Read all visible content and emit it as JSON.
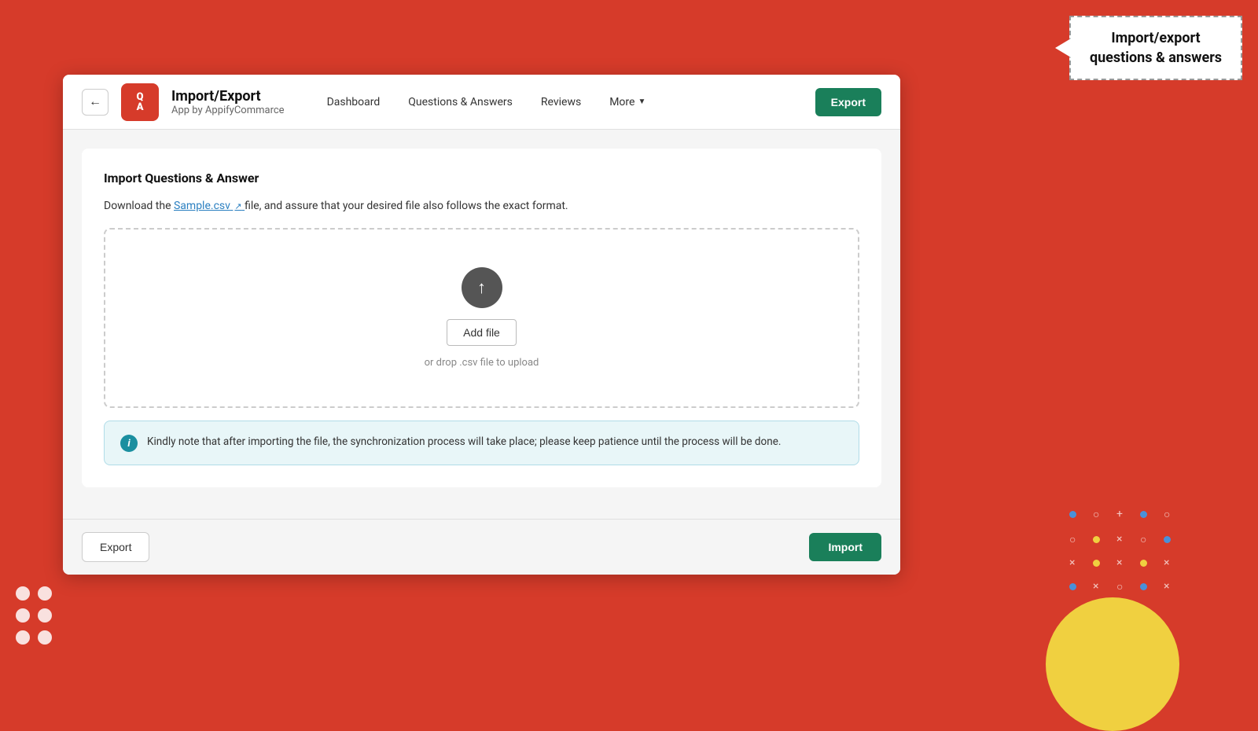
{
  "background": {
    "color": "#d63b2a"
  },
  "annotation": {
    "title": "Import/export questions & answers"
  },
  "header": {
    "back_label": "←",
    "logo_line1": "Q",
    "logo_line2": "A",
    "app_title": "Import/Export",
    "app_subtitle": "App by AppifyCommarce",
    "nav": {
      "dashboard": "Dashboard",
      "questions_answers": "Questions & Answers",
      "reviews": "Reviews",
      "more": "More",
      "export_btn": "Export"
    }
  },
  "main": {
    "import_title": "Import Questions & Answer",
    "download_text_prefix": "Download the ",
    "sample_link": "Sample.csv",
    "download_text_suffix": " file, and assure that your desired file also follows the exact format.",
    "upload": {
      "add_file_btn": "Add file",
      "drop_hint": "or drop .csv file to upload"
    },
    "info_message": "Kindly note that after importing the file, the synchronization process will take place; please keep patience until the process will be done."
  },
  "footer": {
    "export_btn": "Export",
    "import_btn": "Import"
  }
}
